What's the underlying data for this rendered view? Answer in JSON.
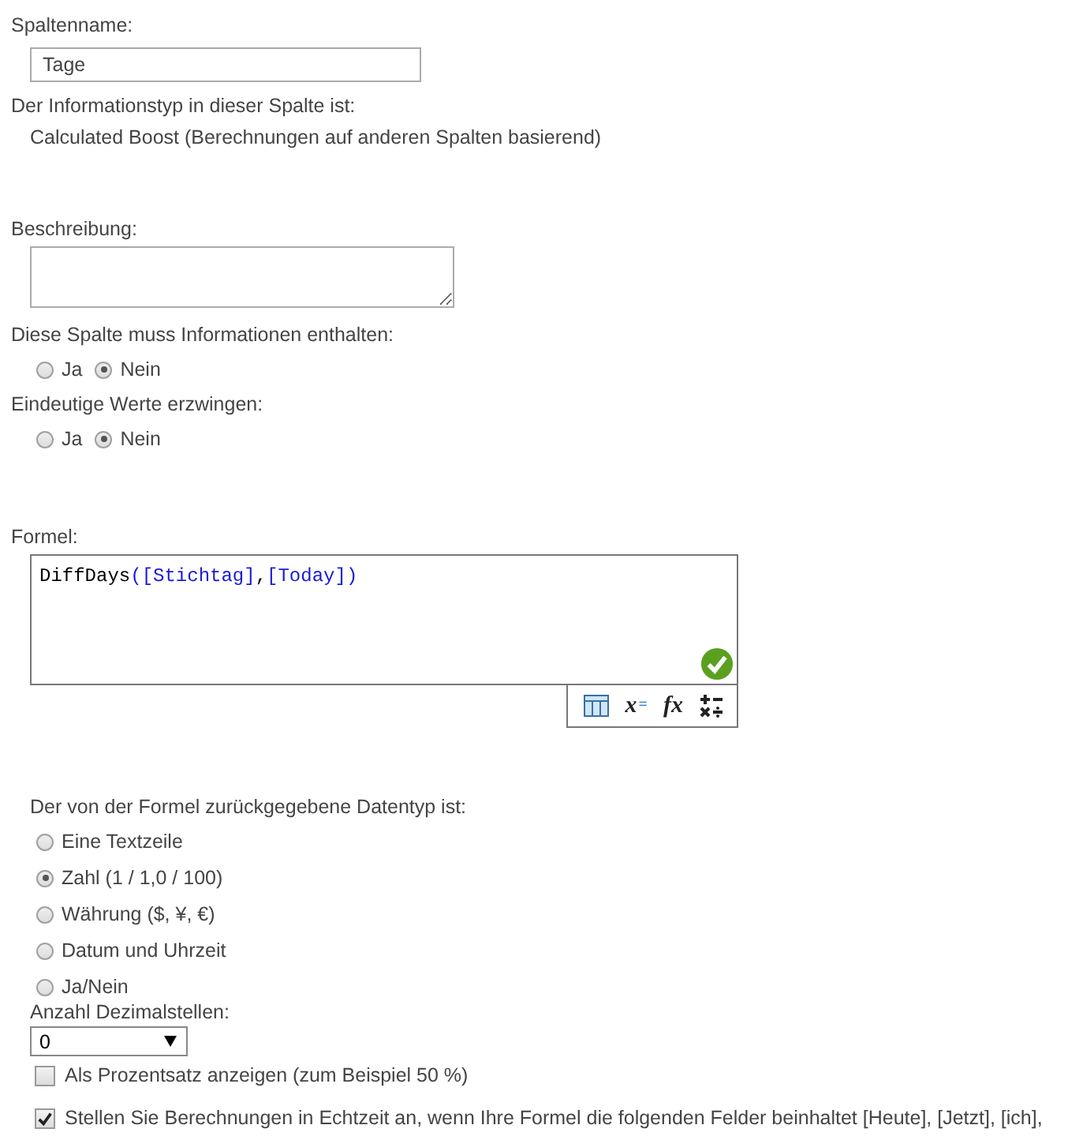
{
  "column_name": {
    "label": "Spaltenname:",
    "value": "Tage"
  },
  "type_info": {
    "label": "Der Informationstyp in dieser Spalte ist:",
    "value": "Calculated Boost (Berechnungen auf anderen Spalten basierend)"
  },
  "description": {
    "label": "Beschreibung:"
  },
  "required": {
    "label": "Diese Spalte muss Informationen enthalten:",
    "options": [
      {
        "label": "Ja",
        "selected": false
      },
      {
        "label": "Nein",
        "selected": true
      }
    ]
  },
  "unique": {
    "label": "Eindeutige Werte erzwingen:",
    "options": [
      {
        "label": "Ja",
        "selected": false
      },
      {
        "label": "Nein",
        "selected": true
      }
    ]
  },
  "formula": {
    "label": "Formel:",
    "valid": true,
    "tokens": [
      {
        "kind": "function",
        "text": "DiffDays"
      },
      {
        "kind": "paren",
        "text": "("
      },
      {
        "kind": "field",
        "text": "[Stichtag]"
      },
      {
        "kind": "punct",
        "text": ","
      },
      {
        "kind": "field",
        "text": "[Today]"
      },
      {
        "kind": "paren",
        "text": ")"
      }
    ],
    "toolbar": [
      {
        "kind": "table"
      },
      {
        "kind": "text",
        "label": "x",
        "suffix": "="
      },
      {
        "kind": "text",
        "label": "fx"
      },
      {
        "kind": "operators"
      }
    ]
  },
  "return_type": {
    "label": "Der von der Formel zurückgegebene Datentyp ist:",
    "options": [
      {
        "label": "Eine Textzeile",
        "selected": false
      },
      {
        "label": "Zahl (1 / 1,0 / 100)",
        "selected": true
      },
      {
        "label": "Währung ($, ¥, €)",
        "selected": false
      },
      {
        "label": "Datum und Uhrzeit",
        "selected": false
      },
      {
        "label": "Ja/Nein",
        "selected": false
      }
    ]
  },
  "decimals": {
    "label": "Anzahl Dezimalstellen:",
    "value": "0"
  },
  "checkboxes": [
    {
      "label": "Als Prozentsatz anzeigen (zum Beispiel 50 %)",
      "checked": false
    },
    {
      "label": "Stellen Sie Berechnungen in Echtzeit an, wenn Ihre Formel die folgenden Felder beinhaltet [Heute], [Jetzt], [ich],",
      "checked": true
    }
  ]
}
